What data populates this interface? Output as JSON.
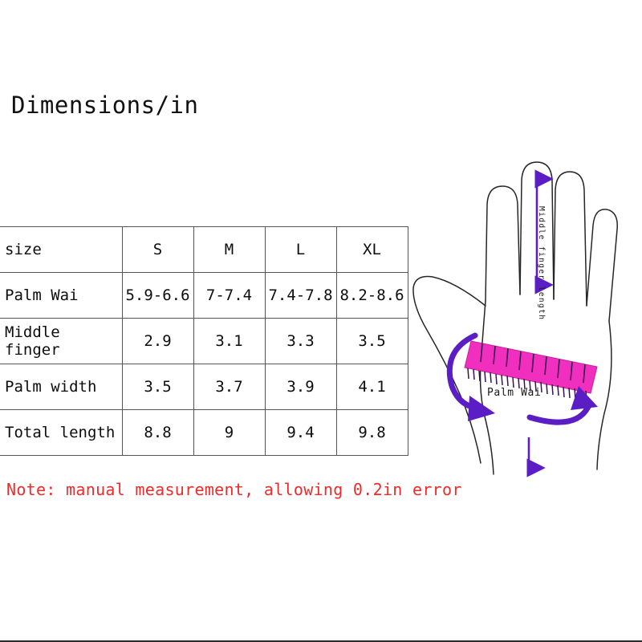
{
  "title": "Dimensions/in",
  "table": {
    "columns": [
      "size",
      "S",
      "M",
      "L",
      "XL"
    ],
    "rows": [
      {
        "label": "Palm Wai",
        "values": [
          "5.9-6.6",
          "7-7.4",
          "7.4-7.8",
          "8.2-8.6"
        ]
      },
      {
        "label": "Middle finger",
        "values": [
          "2.9",
          "3.1",
          "3.3",
          "3.5"
        ]
      },
      {
        "label": "Palm width",
        "values": [
          "3.5",
          "3.7",
          "3.9",
          "4.1"
        ]
      },
      {
        "label": "Total length",
        "values": [
          "8.8",
          "9",
          "9.4",
          "9.8"
        ]
      }
    ]
  },
  "note": "Note: manual measurement, allowing 0.2in error",
  "diagram": {
    "middle_finger_label": "Middle finger length",
    "palm_label": "Palm Wai",
    "colors": {
      "ruler_fill": "#F02FBE",
      "ruler_tick": "#3a1050",
      "arrow": "#5b1ec4",
      "outline": "#262626",
      "note_red": "#ef2a2a"
    }
  }
}
